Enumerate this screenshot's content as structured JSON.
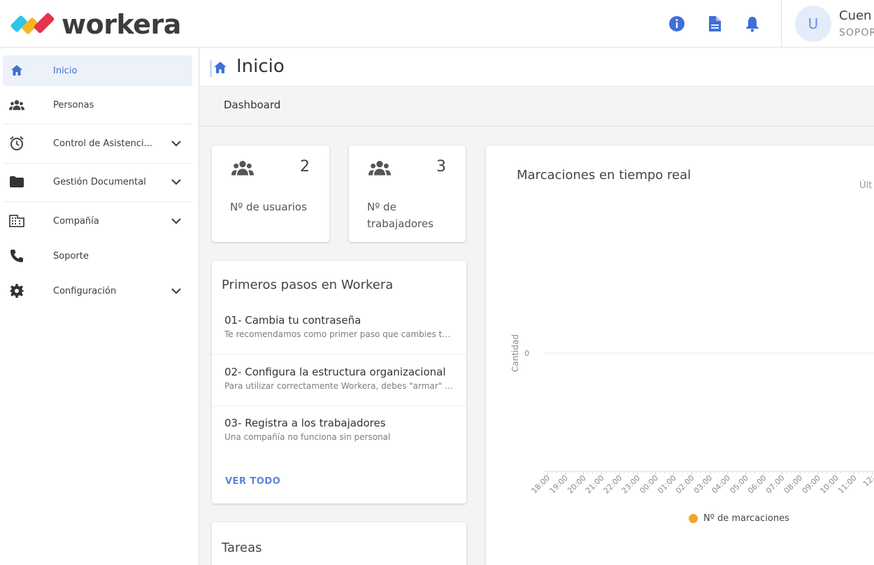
{
  "header": {
    "brand": "workera",
    "logo_colors": [
      "#2ec5e6",
      "#f6b623",
      "#e5334b"
    ],
    "icons": [
      "info-icon",
      "document-icon",
      "bell-icon"
    ],
    "account": {
      "initial": "U",
      "name": "Cuen",
      "subtitle": "SOPOR"
    },
    "accent_color": "#3f6fd8"
  },
  "sidebar": {
    "items": [
      {
        "label": "Inicio",
        "icon": "home-icon",
        "active": true
      },
      {
        "label": "Personas",
        "icon": "people-icon"
      },
      {
        "label": "Control de Asistenci...",
        "icon": "alarm-clock-icon",
        "expandable": true
      },
      {
        "label": "Gestión Documental",
        "icon": "folder-icon",
        "expandable": true
      },
      {
        "label": "Compañía",
        "icon": "building-icon",
        "expandable": true
      },
      {
        "label": "Soporte",
        "icon": "phone-icon"
      },
      {
        "label": "Configuración",
        "icon": "gear-icon",
        "expandable": true
      }
    ]
  },
  "page": {
    "title": "Inicio",
    "tab": "Dashboard"
  },
  "stats": [
    {
      "value": "2",
      "label": "Nº de usuarios",
      "icon": "people-icon"
    },
    {
      "value": "3",
      "label": "Nº de trabajadores",
      "icon": "people-icon"
    }
  ],
  "first_steps": {
    "title": "Primeros pasos en Workera",
    "steps": [
      {
        "title": "01- Cambia tu contraseña",
        "desc": "Te recomendamos como primer paso que cambies tu contraseña"
      },
      {
        "title": "02- Configura la estructura organizacional",
        "desc": "Para utilizar correctamente Workera, debes \"armar\" la estructura"
      },
      {
        "title": "03- Registra a los trabajadores",
        "desc": "Una compañía no funciona sin personal"
      }
    ],
    "see_all": "VER TODO"
  },
  "tasks": {
    "title": "Tareas"
  },
  "chart_panel": {
    "title": "Marcaciones en tiempo real",
    "right_label": "Últ"
  },
  "chart_data": {
    "type": "line",
    "title": "Marcaciones en tiempo real",
    "ylabel": "Cantidad",
    "xlabel": "",
    "x": [
      "18:00",
      "19:00",
      "20:00",
      "21:00",
      "22:00",
      "23:00",
      "00:00",
      "01:00",
      "02:00",
      "03:00",
      "04:00",
      "05:00",
      "06:00",
      "07:00",
      "08:00",
      "09:00",
      "10:00",
      "11:00",
      "12:"
    ],
    "yticks": [
      "0"
    ],
    "series": [
      {
        "name": "Nº de marcaciones",
        "color": "#f0a623",
        "values": [
          0,
          0,
          0,
          0,
          0,
          0,
          0,
          0,
          0,
          0,
          0,
          0,
          0,
          0,
          0,
          0,
          0,
          0,
          0
        ]
      }
    ],
    "legend": "bottom",
    "grid": true
  }
}
